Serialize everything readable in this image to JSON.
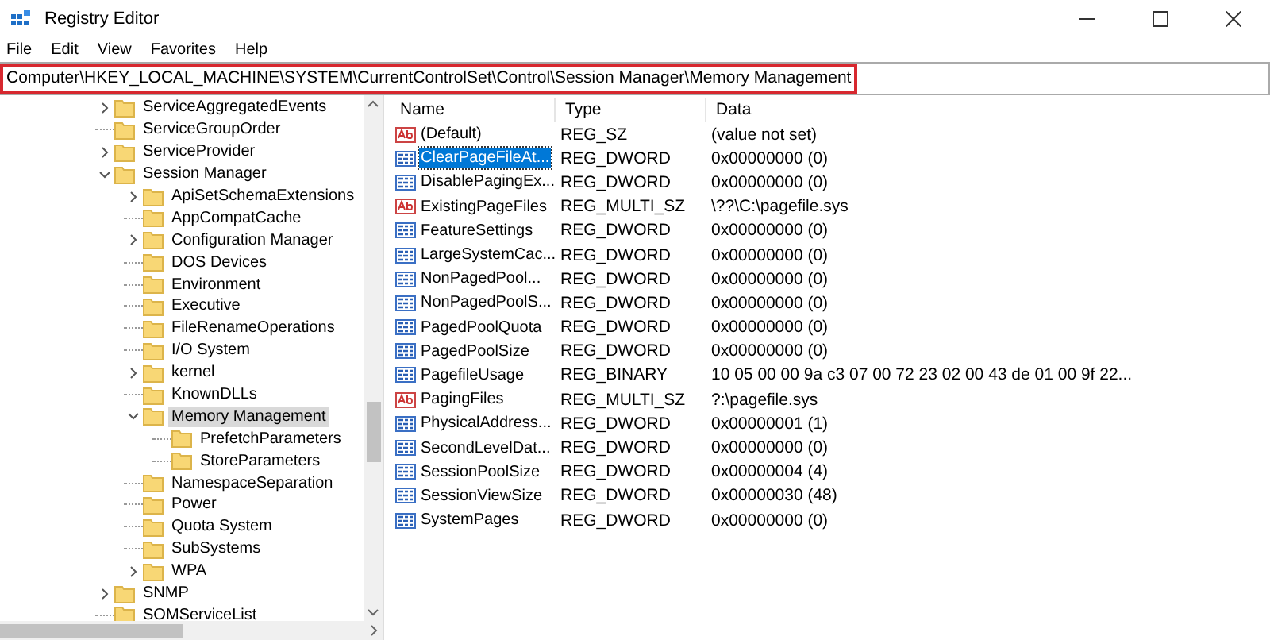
{
  "window": {
    "title": "Registry Editor"
  },
  "menu": [
    "File",
    "Edit",
    "View",
    "Favorites",
    "Help"
  ],
  "address_bar": {
    "value": "Computer\\HKEY_LOCAL_MACHINE\\SYSTEM\\CurrentControlSet\\Control\\Session Manager\\Memory Management",
    "highlighted": true
  },
  "tree": [
    {
      "label": "ServiceAggregatedEvents",
      "kind": "collapsed",
      "selected": false
    },
    {
      "label": "ServiceGroupOrder",
      "kind": "leaf",
      "selected": false
    },
    {
      "label": "ServiceProvider",
      "kind": "collapsed",
      "selected": false
    },
    {
      "label": "Session Manager",
      "kind": "expanded",
      "selected": false,
      "children": [
        {
          "label": "ApiSetSchemaExtensions",
          "kind": "collapsed",
          "selected": false
        },
        {
          "label": "AppCompatCache",
          "kind": "leaf",
          "selected": false
        },
        {
          "label": "Configuration Manager",
          "kind": "collapsed",
          "selected": false
        },
        {
          "label": "DOS Devices",
          "kind": "leaf",
          "selected": false
        },
        {
          "label": "Environment",
          "kind": "leaf",
          "selected": false
        },
        {
          "label": "Executive",
          "kind": "leaf",
          "selected": false
        },
        {
          "label": "FileRenameOperations",
          "kind": "leaf",
          "selected": false
        },
        {
          "label": "I/O System",
          "kind": "leaf",
          "selected": false
        },
        {
          "label": "kernel",
          "kind": "collapsed",
          "selected": false
        },
        {
          "label": "KnownDLLs",
          "kind": "leaf",
          "selected": false
        },
        {
          "label": "Memory Management",
          "kind": "expanded",
          "selected": true,
          "children": [
            {
              "label": "PrefetchParameters",
              "kind": "leaf",
              "selected": false
            },
            {
              "label": "StoreParameters",
              "kind": "leaf",
              "selected": false
            }
          ]
        },
        {
          "label": "NamespaceSeparation",
          "kind": "leaf",
          "selected": false
        },
        {
          "label": "Power",
          "kind": "leaf",
          "selected": false
        },
        {
          "label": "Quota System",
          "kind": "leaf",
          "selected": false
        },
        {
          "label": "SubSystems",
          "kind": "leaf",
          "selected": false
        },
        {
          "label": "WPA",
          "kind": "collapsed",
          "selected": false
        }
      ]
    },
    {
      "label": "SNMP",
      "kind": "collapsed",
      "selected": false
    },
    {
      "label": "SOMServiceList",
      "kind": "leaf",
      "selected": false
    }
  ],
  "values": {
    "columns": [
      "Name",
      "Type",
      "Data"
    ],
    "rows": [
      {
        "kind": "string",
        "name": "(Default)",
        "type": "REG_SZ",
        "data": "(value not set)",
        "selected": false
      },
      {
        "kind": "binary",
        "name": "ClearPageFileAt...",
        "type": "REG_DWORD",
        "data": "0x00000000 (0)",
        "selected": true
      },
      {
        "kind": "binary",
        "name": "DisablePagingEx...",
        "type": "REG_DWORD",
        "data": "0x00000000 (0)",
        "selected": false
      },
      {
        "kind": "string",
        "name": "ExistingPageFiles",
        "type": "REG_MULTI_SZ",
        "data": "\\??\\C:\\pagefile.sys",
        "selected": false
      },
      {
        "kind": "binary",
        "name": "FeatureSettings",
        "type": "REG_DWORD",
        "data": "0x00000000 (0)",
        "selected": false
      },
      {
        "kind": "binary",
        "name": "LargeSystemCac...",
        "type": "REG_DWORD",
        "data": "0x00000000 (0)",
        "selected": false
      },
      {
        "kind": "binary",
        "name": "NonPagedPool...",
        "type": "REG_DWORD",
        "data": "0x00000000 (0)",
        "selected": false
      },
      {
        "kind": "binary",
        "name": "NonPagedPoolS...",
        "type": "REG_DWORD",
        "data": "0x00000000 (0)",
        "selected": false
      },
      {
        "kind": "binary",
        "name": "PagedPoolQuota",
        "type": "REG_DWORD",
        "data": "0x00000000 (0)",
        "selected": false
      },
      {
        "kind": "binary",
        "name": "PagedPoolSize",
        "type": "REG_DWORD",
        "data": "0x00000000 (0)",
        "selected": false
      },
      {
        "kind": "binary",
        "name": "PagefileUsage",
        "type": "REG_BINARY",
        "data": "10 05 00 00 9a c3 07 00 72 23 02 00 43 de 01 00 9f 22...",
        "selected": false
      },
      {
        "kind": "string",
        "name": "PagingFiles",
        "type": "REG_MULTI_SZ",
        "data": "?:\\pagefile.sys",
        "selected": false
      },
      {
        "kind": "binary",
        "name": "PhysicalAddress...",
        "type": "REG_DWORD",
        "data": "0x00000001 (1)",
        "selected": false
      },
      {
        "kind": "binary",
        "name": "SecondLevelDat...",
        "type": "REG_DWORD",
        "data": "0x00000000 (0)",
        "selected": false
      },
      {
        "kind": "binary",
        "name": "SessionPoolSize",
        "type": "REG_DWORD",
        "data": "0x00000004 (4)",
        "selected": false
      },
      {
        "kind": "binary",
        "name": "SessionViewSize",
        "type": "REG_DWORD",
        "data": "0x00000030 (48)",
        "selected": false
      },
      {
        "kind": "binary",
        "name": "SystemPages",
        "type": "REG_DWORD",
        "data": "0x00000000 (0)",
        "selected": false
      }
    ]
  }
}
